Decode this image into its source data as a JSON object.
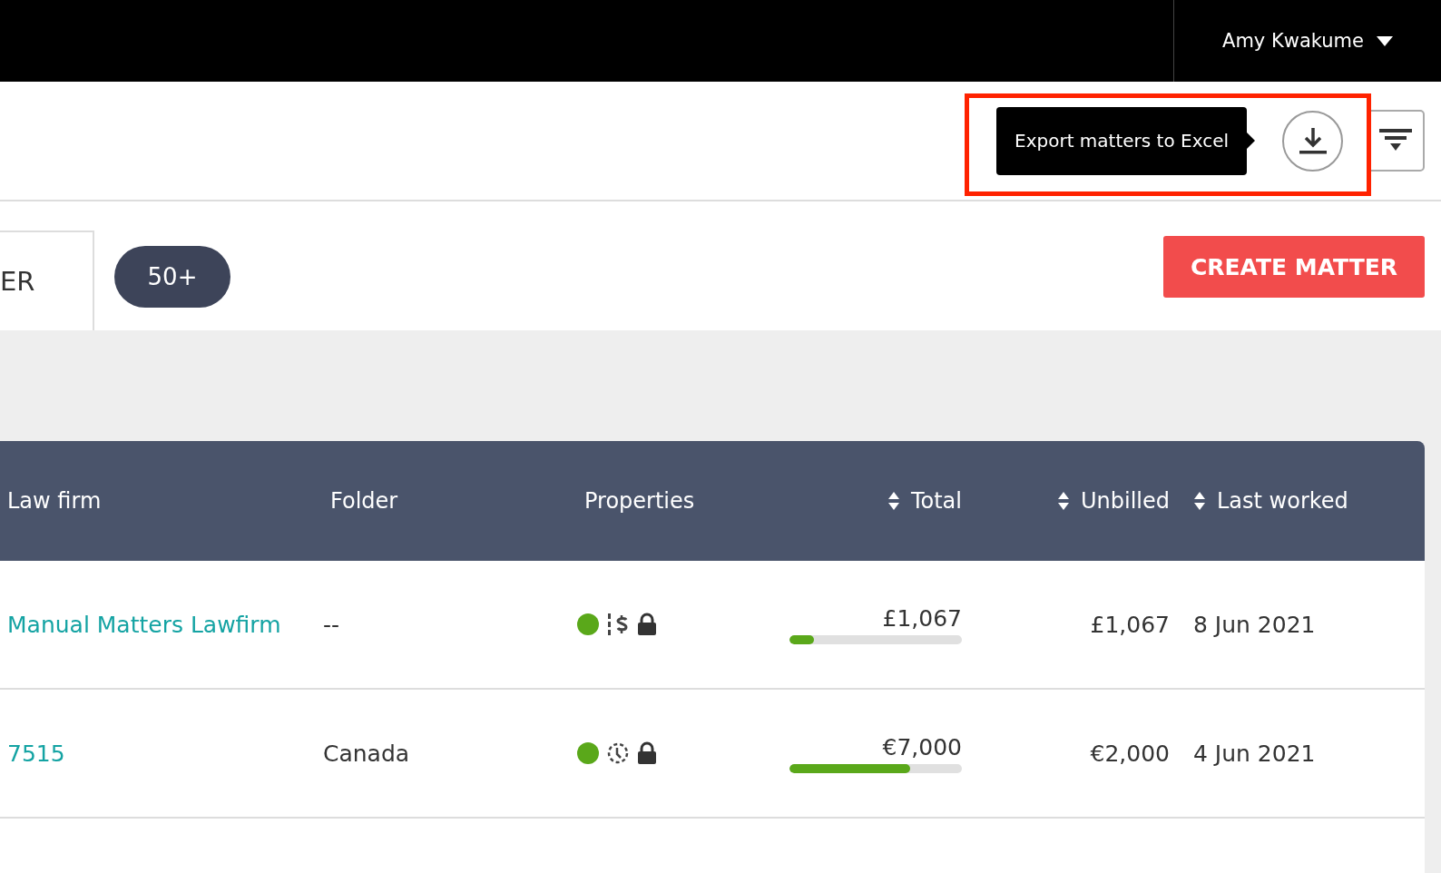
{
  "top_bar": {
    "user_name": "Amy Kwakume"
  },
  "toolbar": {
    "tooltip": "Export matters to Excel"
  },
  "tab_label": "ER",
  "count_badge": "50+",
  "create_button": "CREATE MATTER",
  "table": {
    "columns": [
      {
        "label": "Law firm",
        "sortable": false
      },
      {
        "label": "Folder",
        "sortable": false
      },
      {
        "label": "Properties",
        "sortable": false
      },
      {
        "label": "Total",
        "sortable": true
      },
      {
        "label": "Unbilled",
        "sortable": true
      },
      {
        "label": "Last worked",
        "sortable": true
      }
    ],
    "rows": [
      {
        "law_firm": "Manual Matters Lawfirm",
        "folder": "--",
        "properties": [
          {
            "kind": "status",
            "color": "#5aa81a"
          },
          {
            "kind": "dollar"
          },
          {
            "kind": "lock"
          }
        ],
        "total": "£1,067",
        "level": 0.14,
        "unbilled": "£1,067",
        "last_worked": "8 Jun 2021"
      },
      {
        "law_firm": "7515",
        "folder": "Canada",
        "properties": [
          {
            "kind": "status",
            "color": "#5aa81a"
          },
          {
            "kind": "clock"
          },
          {
            "kind": "lock"
          }
        ],
        "total": "€7,000",
        "level": 0.7,
        "unbilled": "€2,000",
        "last_worked": "4 Jun 2021"
      }
    ]
  }
}
